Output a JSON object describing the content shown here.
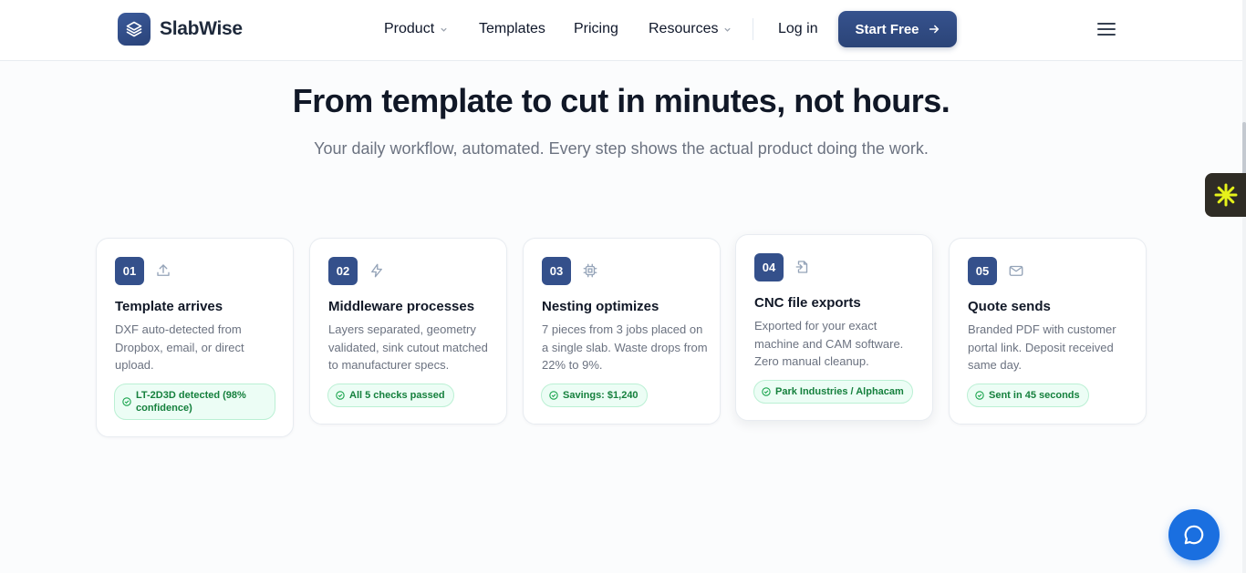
{
  "brand": {
    "name": "SlabWise"
  },
  "nav": {
    "product": "Product",
    "templates": "Templates",
    "pricing": "Pricing",
    "resources": "Resources",
    "login": "Log in",
    "start_free": "Start Free"
  },
  "hero": {
    "headline": "From template to cut in minutes, not hours.",
    "subtitle": "Your daily workflow, automated. Every step shows the actual product doing the work."
  },
  "steps": [
    {
      "number": "01",
      "icon": "upload-icon",
      "title": "Template arrives",
      "description": "DXF auto-detected from Dropbox, email, or direct upload.",
      "badge": "LT-2D3D detected (98% confidence)"
    },
    {
      "number": "02",
      "icon": "lightning-icon",
      "title": "Middleware processes",
      "description": "Layers separated, geometry validated, sink cutout matched to manufacturer specs.",
      "badge": "All 5 checks passed"
    },
    {
      "number": "03",
      "icon": "cpu-icon",
      "title": "Nesting optimizes",
      "description": "7 pieces from 3 jobs placed on a single slab. Waste drops from 22% to 9%.",
      "badge": "Savings: $1,240"
    },
    {
      "number": "04",
      "icon": "file-export-icon",
      "title": "CNC file exports",
      "description": "Exported for your exact machine and CAM software. Zero manual cleanup.",
      "badge": "Park Industries / Alphacam"
    },
    {
      "number": "05",
      "icon": "mail-icon",
      "title": "Quote sends",
      "description": "Branded PDF with customer portal link. Deposit received same day.",
      "badge": "Sent in 45 seconds"
    }
  ],
  "colors": {
    "accent": "#34508b",
    "success": "#15803d",
    "chat": "#1a6fe0"
  }
}
